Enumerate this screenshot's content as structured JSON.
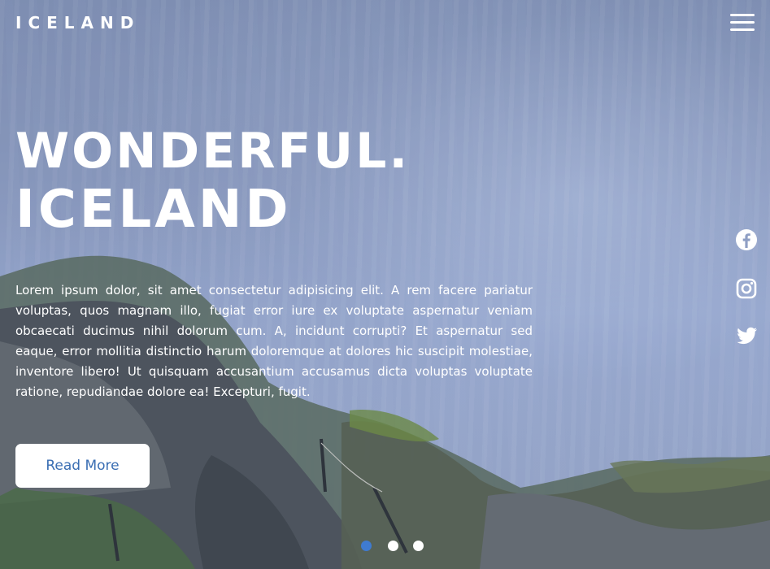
{
  "brand": {
    "logo_text": "ICELAND"
  },
  "header": {
    "menu_icon": "hamburger-menu-icon"
  },
  "hero": {
    "headline_line1": "WONDERFUL.",
    "headline_line2": "ICELAND",
    "description": "Lorem ipsum dolor, sit amet consectetur adipisicing elit. A rem facere pariatur voluptas, quos magnam illo, fugiat error iure ex voluptate aspernatur veniam obcaecati ducimus nihil dolorum cum. A, incidunt corrupti? Et aspernatur sed eaque, error mollitia distinctio harum doloremque at dolores hic suscipit molestiae, inventore libero! Ut quisquam accusantium accusamus dicta voluptas voluptate ratione, repudiandae dolore ea! Excepturi, fugit.",
    "button_label": "Read More"
  },
  "social": [
    {
      "name": "facebook",
      "icon": "facebook-icon"
    },
    {
      "name": "instagram",
      "icon": "instagram-icon"
    },
    {
      "name": "twitter",
      "icon": "twitter-icon"
    }
  ],
  "slider": {
    "dot_count": 3,
    "active_index": 0
  },
  "colors": {
    "button_text": "#3a6eb3",
    "active_dot": "#3f7bd1",
    "text": "#ffffff"
  }
}
